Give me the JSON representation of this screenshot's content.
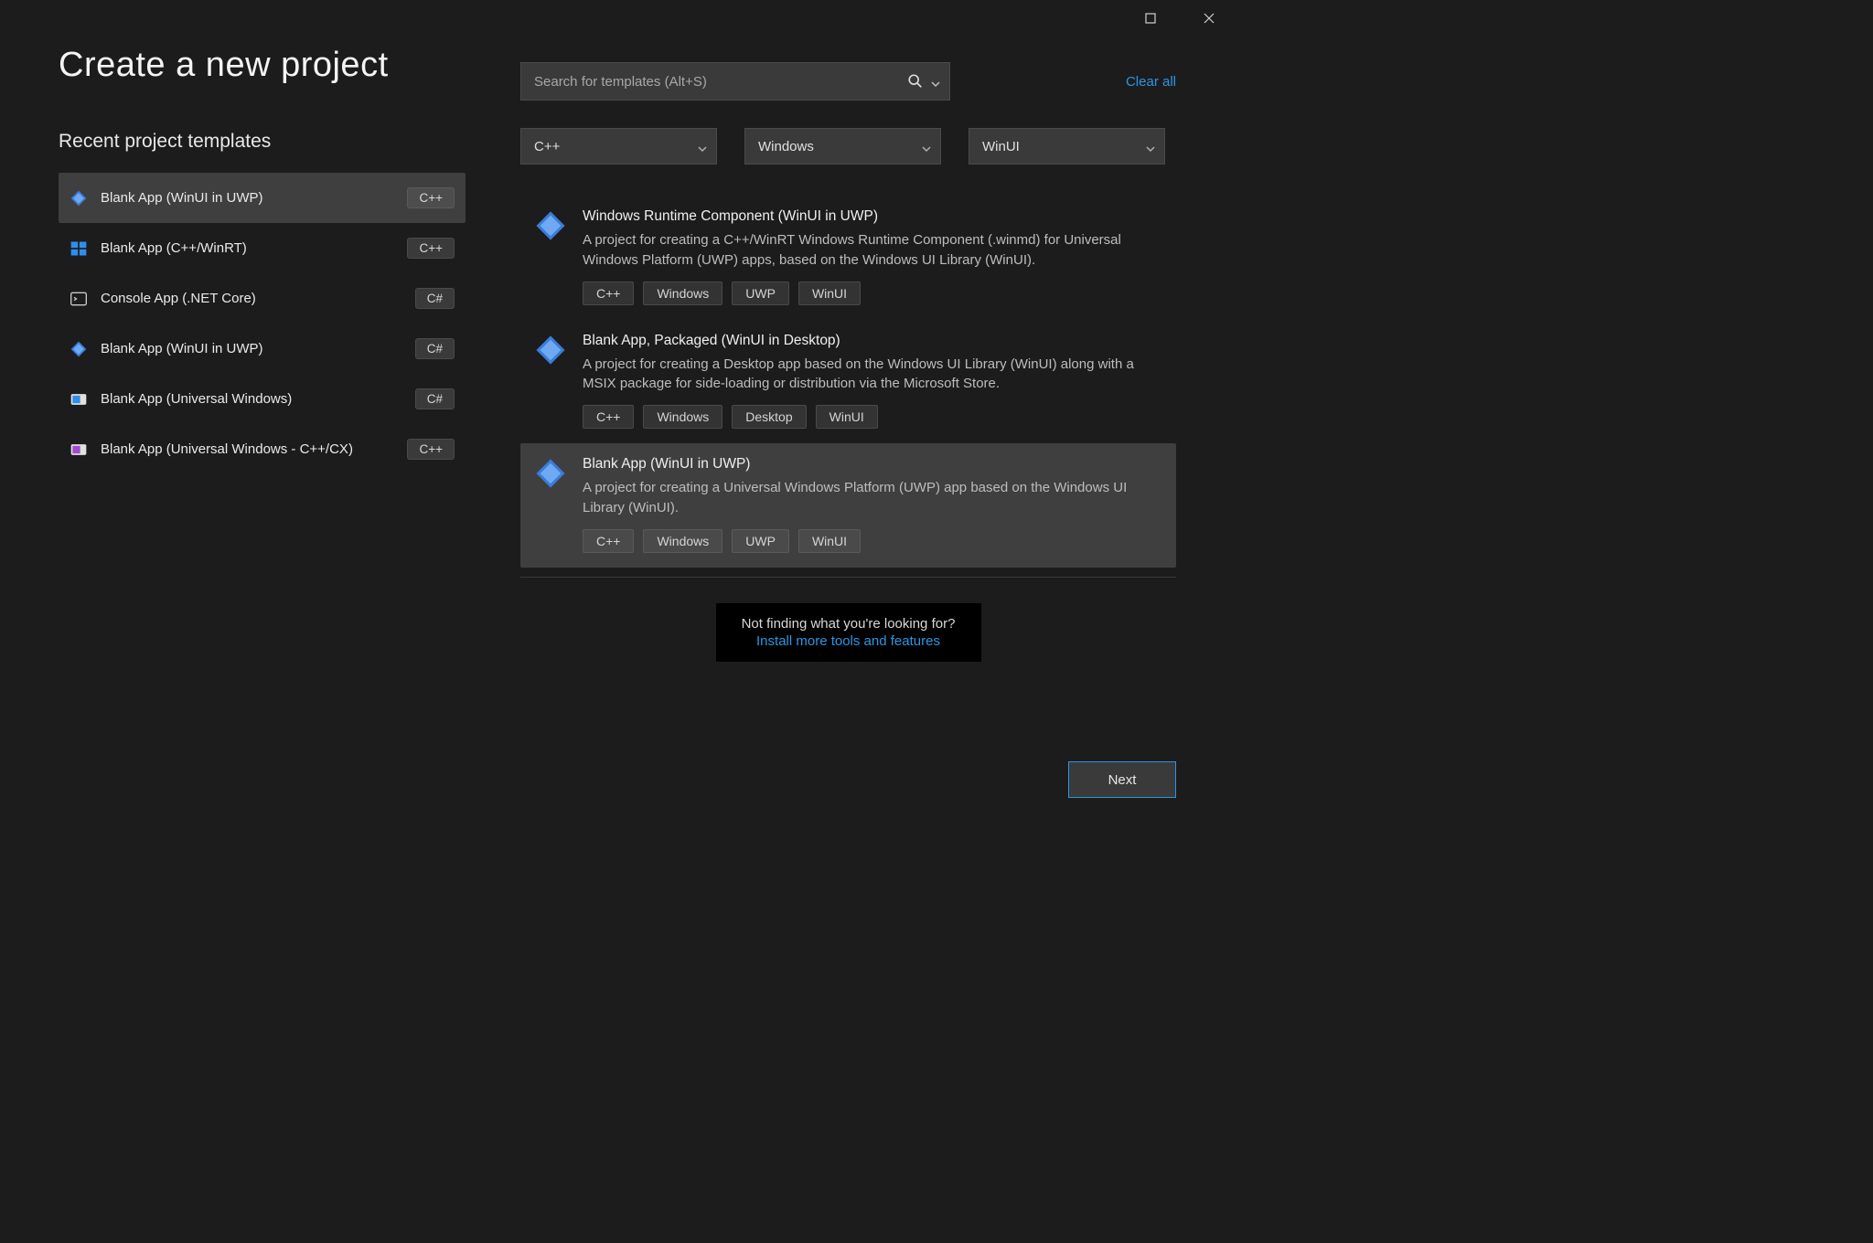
{
  "header": {
    "title": "Create a new project"
  },
  "recent": {
    "heading": "Recent project templates",
    "items": [
      {
        "label": "Blank App (WinUI in UWP)",
        "lang": "C++",
        "icon": "winui"
      },
      {
        "label": "Blank App (C++/WinRT)",
        "lang": "C++",
        "icon": "winlogo"
      },
      {
        "label": "Console App (.NET Core)",
        "lang": "C#",
        "icon": "console"
      },
      {
        "label": "Blank App (WinUI in UWP)",
        "lang": "C#",
        "icon": "winui"
      },
      {
        "label": "Blank App (Universal Windows)",
        "lang": "C#",
        "icon": "uwp"
      },
      {
        "label": "Blank App (Universal Windows - C++/CX)",
        "lang": "C++",
        "icon": "uwp-cpp"
      }
    ]
  },
  "search": {
    "placeholder": "Search for templates (Alt+S)",
    "clear_label": "Clear all"
  },
  "filters": {
    "language": "C++",
    "platform": "Windows",
    "project_type": "WinUI"
  },
  "results": [
    {
      "title": "Windows Runtime Component (WinUI in UWP)",
      "desc": "A project for creating a C++/WinRT Windows Runtime Component (.winmd) for Universal Windows Platform (UWP) apps, based on the Windows UI Library (WinUI).",
      "tags": [
        "C++",
        "Windows",
        "UWP",
        "WinUI"
      ],
      "selected": false
    },
    {
      "title": "Blank App, Packaged (WinUI in Desktop)",
      "desc": "A project for creating a Desktop app based on the Windows UI Library (WinUI) along with a MSIX package for side-loading or distribution via the Microsoft Store.",
      "tags": [
        "C++",
        "Windows",
        "Desktop",
        "WinUI"
      ],
      "selected": false
    },
    {
      "title": "Blank App (WinUI in UWP)",
      "desc": "A project for creating a Universal Windows Platform (UWP) app based on the Windows UI Library (WinUI).",
      "tags": [
        "C++",
        "Windows",
        "UWP",
        "WinUI"
      ],
      "selected": true
    }
  ],
  "not_finding": {
    "text": "Not finding what you're looking for?",
    "link": "Install more tools and features"
  },
  "footer": {
    "next_label": "Next"
  }
}
